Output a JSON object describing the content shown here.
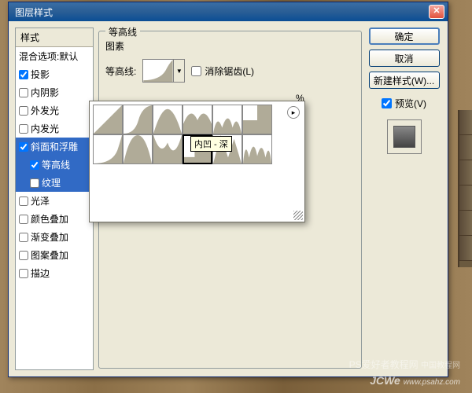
{
  "dialog": {
    "title": "图层样式"
  },
  "sidebar": {
    "header": "样式",
    "blend_defaults": "混合选项:默认",
    "items": [
      {
        "label": "投影",
        "checked": true
      },
      {
        "label": "内阴影",
        "checked": false
      },
      {
        "label": "外发光",
        "checked": false
      },
      {
        "label": "内发光",
        "checked": false
      },
      {
        "label": "斜面和浮雕",
        "checked": true,
        "selected": false
      },
      {
        "label": "等高线",
        "checked": true,
        "indent": true,
        "selected": true
      },
      {
        "label": "纹理",
        "checked": false,
        "indent": true
      },
      {
        "label": "光泽",
        "checked": false
      },
      {
        "label": "颜色叠加",
        "checked": false
      },
      {
        "label": "渐变叠加",
        "checked": false
      },
      {
        "label": "图案叠加",
        "checked": false
      },
      {
        "label": "描边",
        "checked": false
      }
    ]
  },
  "center": {
    "group_title": "等高线",
    "sub_title": "图素",
    "contour_label": "等高线:",
    "antialias_label": "消除锯齿(L)",
    "range_percent": "%"
  },
  "buttons": {
    "ok": "确定",
    "cancel": "取消",
    "new_style": "新建样式(W)...",
    "preview": "预览(V)"
  },
  "tooltip": "内凹 - 深",
  "watermark": {
    "line1": "PS爱好者教程网",
    "line2": "www.psahz.com",
    "jcwe": "JCWe"
  }
}
